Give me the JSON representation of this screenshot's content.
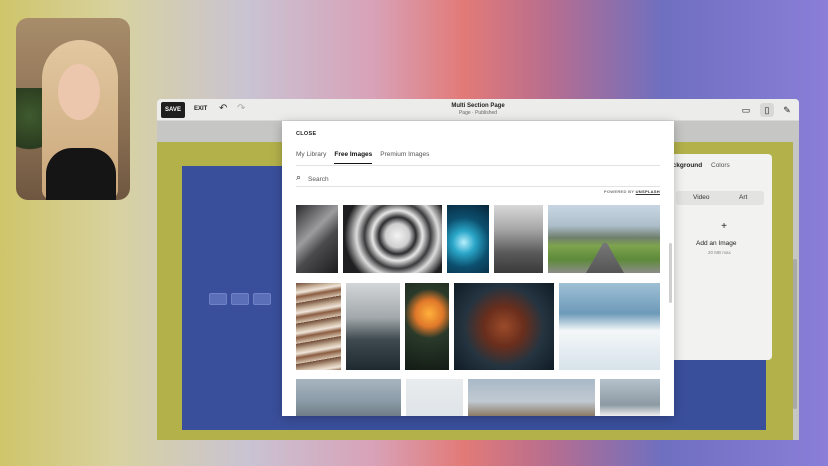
{
  "toolbar": {
    "save_label": "SAVE",
    "exit_label": "EXIT",
    "undo_icon": "↶",
    "redo_icon": "↷",
    "page_title": "Multi Section Page",
    "page_status": "Page · Published",
    "desktop_icon": "▭",
    "mobile_icon": "▯",
    "brush_icon": "✎"
  },
  "panel": {
    "tab_background": "ackground",
    "tab_colors": "Colors",
    "segment_video": "Video",
    "segment_art": "Art",
    "add_icon": "+",
    "add_label": "Add an Image",
    "add_sub": "20 MB max"
  },
  "modal": {
    "close_label": "CLOSE",
    "tabs": [
      "My Library",
      "Free Images",
      "Premium Images"
    ],
    "active_tab": "Free Images",
    "search_icon": "⌕",
    "search_placeholder": "Search",
    "powered_prefix": "POWERED BY ",
    "powered_brand": "UNSPLASH"
  },
  "colors": {
    "canvas_olive": "#b3b14a",
    "canvas_blue": "#3a4f9c",
    "save_button_bg": "#1e1e1e"
  }
}
